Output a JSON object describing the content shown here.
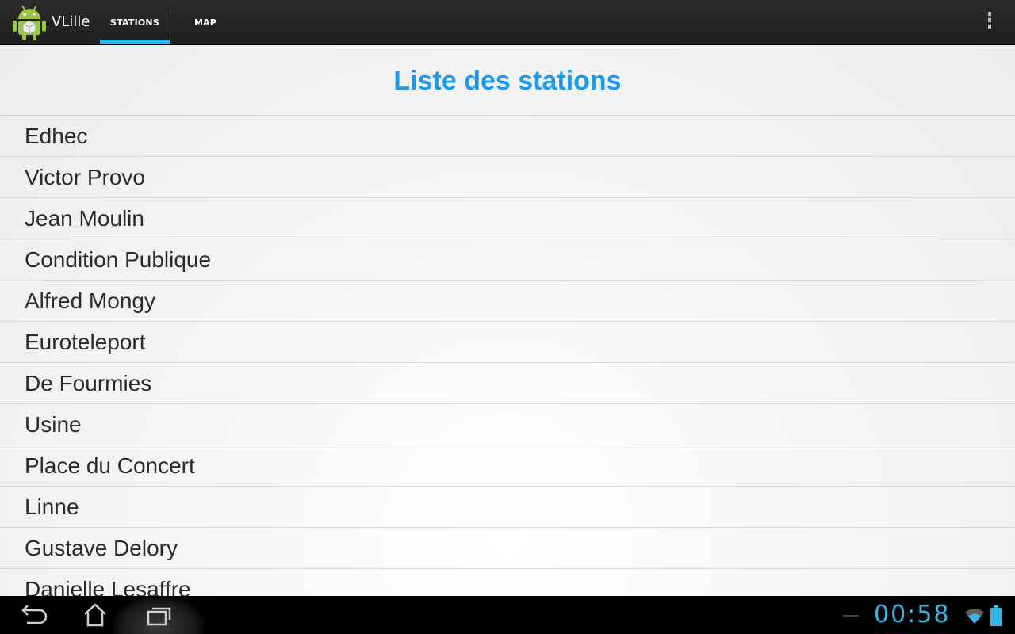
{
  "app": {
    "title": "VLille",
    "icon": "android-icon"
  },
  "tabs": [
    {
      "label": "STATIONS",
      "selected": true
    },
    {
      "label": "MAP",
      "selected": false
    }
  ],
  "colors": {
    "accent": "#33b5e5",
    "title": "#1b9bf0"
  },
  "main": {
    "title": "Liste des stations",
    "stations": [
      "Edhec",
      "Victor Provo",
      "Jean Moulin",
      "Condition Publique",
      "Alfred Mongy",
      "Euroteleport",
      "De Fourmies",
      "Usine",
      "Place du Concert",
      "Linne",
      "Gustave Delory",
      "Danielle Lesaffre"
    ]
  },
  "status_bar": {
    "time": "00:58",
    "icons": [
      "wifi-icon",
      "battery-icon"
    ]
  }
}
